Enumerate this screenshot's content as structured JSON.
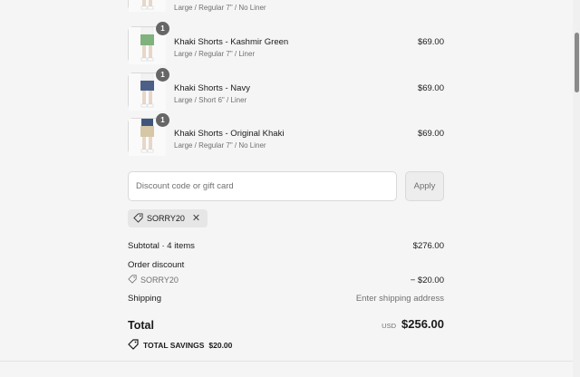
{
  "items": [
    {
      "name": "",
      "variant": "Large / Regular 7\" / No Liner",
      "price": "",
      "qty": "",
      "shorts_color": "#d9cbb0"
    },
    {
      "name": "Khaki Shorts - Kashmir Green",
      "variant": "Large / Regular 7\" / Liner",
      "price": "$69.00",
      "qty": "1",
      "shorts_color": "#7fb27c"
    },
    {
      "name": "Khaki Shorts - Navy",
      "variant": "Large / Short 6\" / Liner",
      "price": "$69.00",
      "qty": "1",
      "shorts_color": "#4c5f86"
    },
    {
      "name": "Khaki Shorts - Original Khaki",
      "variant": "Large / Regular 7\" / No Liner",
      "price": "$69.00",
      "qty": "1",
      "shorts_color": "#d6c7a6"
    }
  ],
  "discount": {
    "placeholder": "Discount code or gift card",
    "value": "",
    "apply_label": "Apply"
  },
  "applied_code": {
    "label": "SORRY20",
    "remove_symbol": "✕",
    "icon": "tag-icon"
  },
  "summary": {
    "subtotal_label": "Subtotal · 4 items",
    "subtotal_value": "$276.00",
    "order_discount_label": "Order discount",
    "discount_code": "SORRY20",
    "discount_value": "− $20.00",
    "shipping_label": "Shipping",
    "shipping_value": "Enter shipping address",
    "total_label": "Total",
    "currency": "USD",
    "total_value": "$256.00",
    "savings_label": "TOTAL SAVINGS",
    "savings_value": "$20.00"
  },
  "scrollbar": {
    "position_fraction": 0.1
  }
}
